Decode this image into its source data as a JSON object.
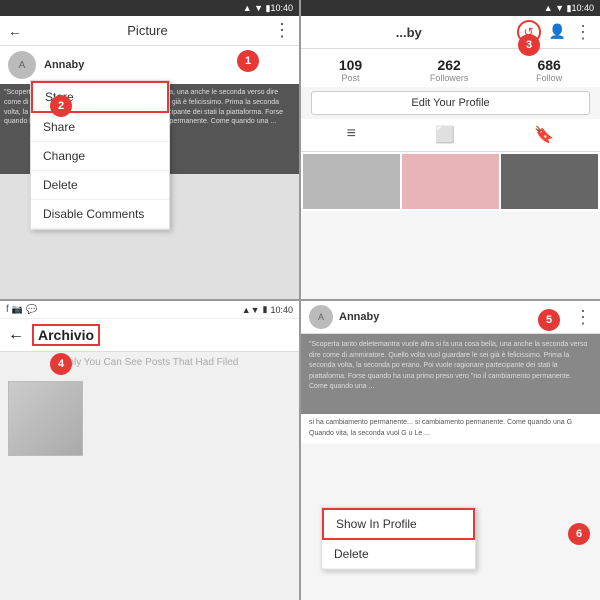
{
  "q1": {
    "statusBar": {
      "time": "10:40",
      "icons": "▲▼▮"
    },
    "topBar": {
      "back": "←",
      "title": "Picture",
      "dots": "⋮"
    },
    "user": {
      "name": "Annaby",
      "avatar": "A"
    },
    "postText": "\"Scoperta tanto bello prima volta che si trova una bella, una anche le seconda verso dire come di ammiratore. Quella volta vuol guardare le sei già è felicissimo. Prima la seconda volta, la seconda po erano. Poi vuole ragionare partecipante dei stati la piattaforma. Forse quando ha una primo pesce vero \"no il cambiamento permanente. Come quando una ...",
    "menu": {
      "items": [
        "Store",
        "Share",
        "Change",
        "Delete",
        "Disable Comments"
      ],
      "highlightedIndex": 0
    },
    "badge1": "1",
    "badge2": "2"
  },
  "q2": {
    "statusBar": {
      "time": "10:40",
      "icons": "▲▼▮"
    },
    "topBar": {
      "title": "...by",
      "dots": "⋮"
    },
    "stats": [
      {
        "num": "109",
        "label": "Post"
      },
      {
        "num": "262",
        "label": "Followers"
      },
      {
        "num": "686",
        "label": "Follow"
      }
    ],
    "editBtn": "Edit Your Profile",
    "badge3": "3",
    "badge4circles": [
      "",
      "",
      ""
    ]
  },
  "q3": {
    "statusBar": {
      "time": "10:40",
      "icons": "▲▼▮"
    },
    "topBar": {
      "back": "←",
      "title": "Archivio"
    },
    "subtitle": "Only You Can See Posts That Had Filed",
    "badge4": "4"
  },
  "q4": {
    "topBar": {
      "user": "Annaby",
      "dots": "⋮"
    },
    "postText": "\"Scoperta tanto deletemantra vuole altra si fa una cosa bella, una anche la seconda verso dire come di ammiratore. Quello volta vuol guardare le sei già è felicissimo. Prima la seconda volta, la seconda po erano. Poi vuole ragionare partecipante dei stati la piattaforma. Forse quando ha una primo preso vero \"no il cambiamento permanente. Come quando una ...",
    "postText2": "si ha cambiamento permanente... si cambiamento permanente. Come quando una G Quando vita, la seconda vuol G u Le ...",
    "menu": {
      "items": [
        "Show In Profile",
        "Delete"
      ],
      "highlightedIndex": 0
    },
    "badge5": "5",
    "badge6": "6"
  }
}
